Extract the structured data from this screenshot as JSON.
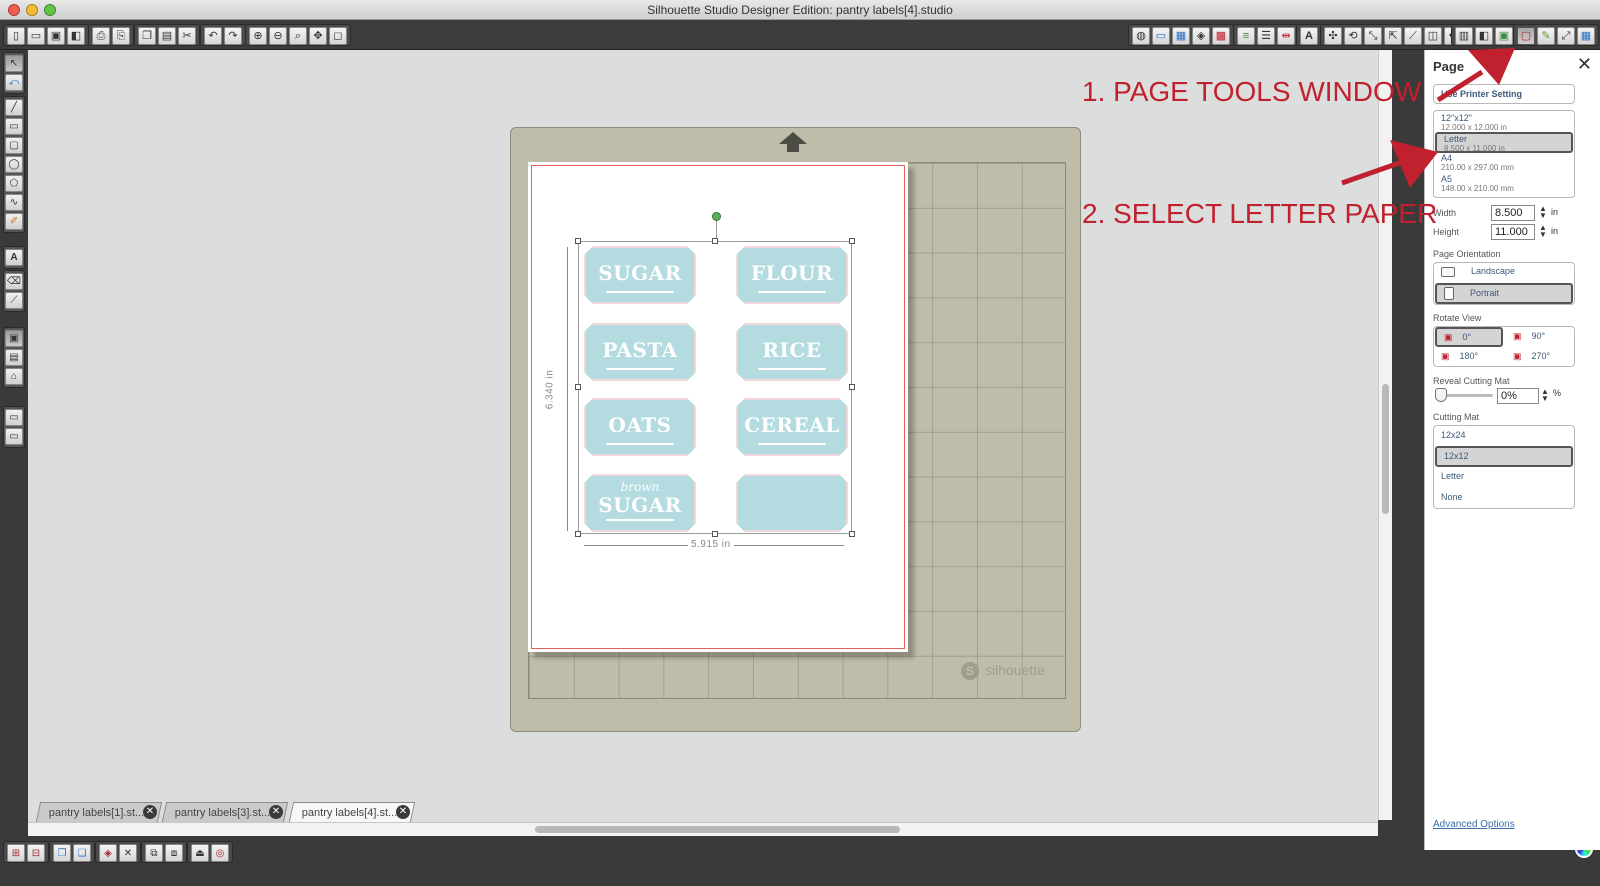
{
  "window": {
    "title": "Silhouette Studio Designer Edition: pantry labels[4].studio",
    "traffic_lights": [
      "#ee5c54",
      "#f5bd34",
      "#62c447"
    ]
  },
  "toolbar": {
    "left_icons": [
      "new-icon",
      "open-icon",
      "save-icon",
      "save-as-icon",
      "print-icon",
      "print-cut-icon",
      "copy-icon",
      "paste-icon",
      "cut-icon",
      "undo-icon",
      "redo-icon",
      "zoom-in-icon",
      "zoom-out-icon",
      "zoom-select-icon",
      "pan-icon",
      "fit-page-icon"
    ],
    "right_icons": [
      "fill-icon",
      "line-color-icon",
      "gradient-icon",
      "pattern-icon",
      "shadow-icon",
      "line-style-icon",
      "align-icon",
      "replicate-icon",
      "text-style-icon",
      "transform-icon",
      "rotate-icon",
      "scale-icon",
      "move-icon",
      "knife-icon",
      "offset-icon",
      "trace-icon",
      "library-icon",
      "page-setup-icon",
      "sketch-icon",
      "cut-settings-icon",
      "send-icon"
    ]
  },
  "left_tools": [
    "select-tool",
    "point-edit-tool",
    "line-tool",
    "rectangle-tool",
    "rounded-rect-tool",
    "ellipse-tool",
    "polygon-tool",
    "curve-tool",
    "freehand-tool",
    "text-tool",
    "eraser-tool",
    "knife-tool",
    "design-page-tool",
    "library-tool",
    "store-tool",
    "panel-tool"
  ],
  "canvas": {
    "dimension_height": "6.340 in",
    "dimension_width": "5.915 in",
    "mat_logo": "silhouette",
    "labels": [
      {
        "text": "SUGAR",
        "sub": ""
      },
      {
        "text": "FLOUR",
        "sub": ""
      },
      {
        "text": "PASTA",
        "sub": ""
      },
      {
        "text": "RICE",
        "sub": ""
      },
      {
        "text": "OATS",
        "sub": ""
      },
      {
        "text": "CEREAL",
        "sub": ""
      },
      {
        "text": "SUGAR",
        "sub": "brown"
      },
      {
        "text": "",
        "sub": ""
      }
    ],
    "label_color": "#b3dbe0"
  },
  "annotations": {
    "step1": "1. PAGE TOOLS WINDOW",
    "step2": "2. SELECT LETTER PAPER",
    "color": "#c1202e"
  },
  "doc_tabs": [
    {
      "label": "pantry labels[1].st...",
      "active": false
    },
    {
      "label": "pantry labels[3].st...",
      "active": false
    },
    {
      "label": "pantry labels[4].st...",
      "active": true
    }
  ],
  "page_panel": {
    "title": "Page",
    "use_printer_setting": "Use Printer Setting",
    "sizes": [
      {
        "name": "12\"x12\"",
        "dims": "12.000 x 12.000 in",
        "selected": false
      },
      {
        "name": "Letter",
        "dims": "8.500 x 11.000 in",
        "selected": true
      },
      {
        "name": "A4",
        "dims": "210.00 x 297.00 mm",
        "selected": false
      },
      {
        "name": "A5",
        "dims": "148.00 x 210.00 mm",
        "selected": false
      }
    ],
    "width_label": "Width",
    "width_value": "8.500",
    "height_label": "Height",
    "height_value": "11.000",
    "unit": "in",
    "orientation_heading": "Page Orientation",
    "orientations": [
      {
        "label": "Landscape",
        "selected": false
      },
      {
        "label": "Portrait",
        "selected": true
      }
    ],
    "rotate_heading": "Rotate View",
    "rotations": [
      {
        "label": "0°",
        "selected": true
      },
      {
        "label": "90°",
        "selected": false
      },
      {
        "label": "180°",
        "selected": false
      },
      {
        "label": "270°",
        "selected": false
      }
    ],
    "reveal_heading": "Reveal Cutting Mat",
    "reveal_value": "0%",
    "reveal_unit": "%",
    "mat_heading": "Cutting Mat",
    "mats": [
      {
        "label": "12x24",
        "selected": false
      },
      {
        "label": "12x12",
        "selected": true
      },
      {
        "label": "Letter",
        "selected": false
      },
      {
        "label": "None",
        "selected": false
      }
    ],
    "advanced": "Advanced Options"
  }
}
